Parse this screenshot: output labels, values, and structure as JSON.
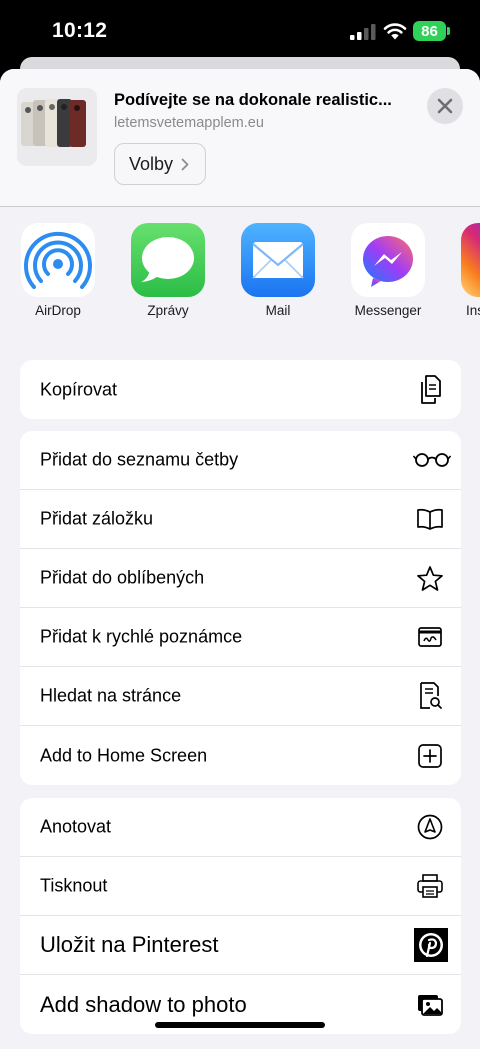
{
  "status_bar": {
    "time": "10:12",
    "battery": "86"
  },
  "sheet": {
    "header": {
      "title": "Podívejte se na dokonale realistic...",
      "url": "letemsvetemapplem.eu",
      "options_label": "Volby"
    },
    "share_apps": [
      {
        "label": "AirDrop",
        "icon": "airdrop-icon"
      },
      {
        "label": "Zprávy",
        "icon": "messages-icon"
      },
      {
        "label": "Mail",
        "icon": "mail-icon"
      },
      {
        "label": "Messenger",
        "icon": "messenger-icon"
      },
      {
        "label": "Ins",
        "icon": "instagram-icon"
      }
    ],
    "groups": [
      {
        "actions": [
          {
            "label": "Kopírovat",
            "icon": "copy-icon"
          }
        ]
      },
      {
        "actions": [
          {
            "label": "Přidat do seznamu četby",
            "icon": "glasses-icon"
          },
          {
            "label": "Přidat záložku",
            "icon": "book-icon"
          },
          {
            "label": "Přidat do oblíbených",
            "icon": "star-icon"
          },
          {
            "label": "Přidat k rychlé poznámce",
            "icon": "quick-note-icon"
          },
          {
            "label": "Hledat na stránce",
            "icon": "find-on-page-icon"
          },
          {
            "label": "Add to Home Screen",
            "icon": "add-square-icon"
          }
        ]
      },
      {
        "actions": [
          {
            "label": "Anotovat",
            "icon": "markup-icon"
          },
          {
            "label": "Tisknout",
            "icon": "printer-icon"
          },
          {
            "label": "Uložit na Pinterest",
            "icon": "pinterest-icon"
          },
          {
            "label": "Add shadow to photo",
            "icon": "photo-icon"
          }
        ]
      }
    ]
  },
  "colors": {
    "messages_green": "#34c759",
    "mail_blue": "#1f8ef8",
    "airdrop_blue": "#2d8cf0",
    "battery_green": "#30d158"
  }
}
